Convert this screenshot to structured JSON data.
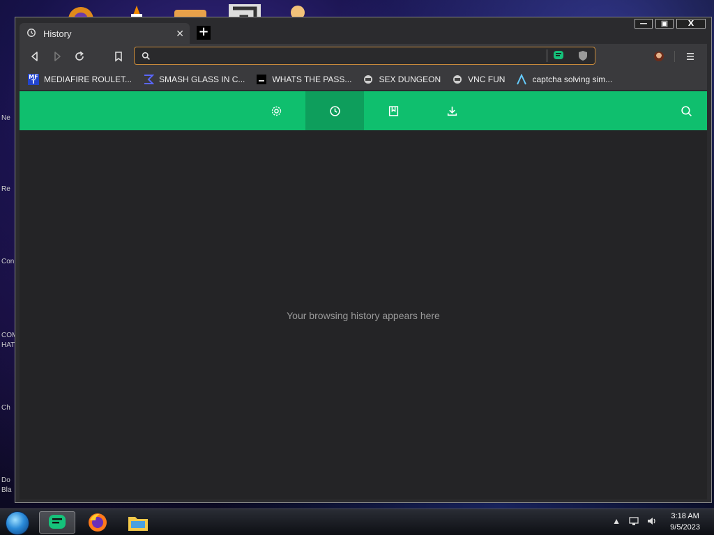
{
  "window": {
    "tab_title": "History",
    "tab_icon": "history-icon",
    "new_tab_glyph": "+"
  },
  "window_controls": {
    "minimize": "—",
    "maximize": "▣",
    "close": "X"
  },
  "toolbar": {
    "url_value": "",
    "url_placeholder": ""
  },
  "bookmarks": [
    {
      "label": "MEDIAFIRE ROULET...",
      "icon": "mediafire-icon",
      "color": "#2244cc"
    },
    {
      "label": "SMASH GLASS IN C...",
      "icon": "sigma-icon",
      "color": "#3b47d6"
    },
    {
      "label": "WHATS THE PASS...",
      "icon": "terminal-icon",
      "color": "#000000"
    },
    {
      "label": "SEX DUNGEON",
      "icon": "badge-icon",
      "color": "#cfcfcf"
    },
    {
      "label": "VNC FUN",
      "icon": "badge-icon",
      "color": "#cfcfcf"
    },
    {
      "label": "captcha solving sim...",
      "icon": "lambda-icon",
      "color": "#66ccff"
    }
  ],
  "nav": {
    "active": "history",
    "items": [
      "settings",
      "history",
      "bookmarks",
      "downloads"
    ]
  },
  "content": {
    "empty_message": "Your browsing history appears here"
  },
  "desktop_left_labels": [
    "Ne",
    "Re",
    "Con",
    "COM",
    "HATE",
    "Ch",
    "Do",
    "Bla"
  ],
  "taskbar": {
    "time": "3:18 AM",
    "date": "9/5/2023"
  },
  "colors": {
    "accent_green": "#0fbf6e",
    "accent_green_active": "#0e9e5c",
    "url_border": "#c98a3a"
  }
}
